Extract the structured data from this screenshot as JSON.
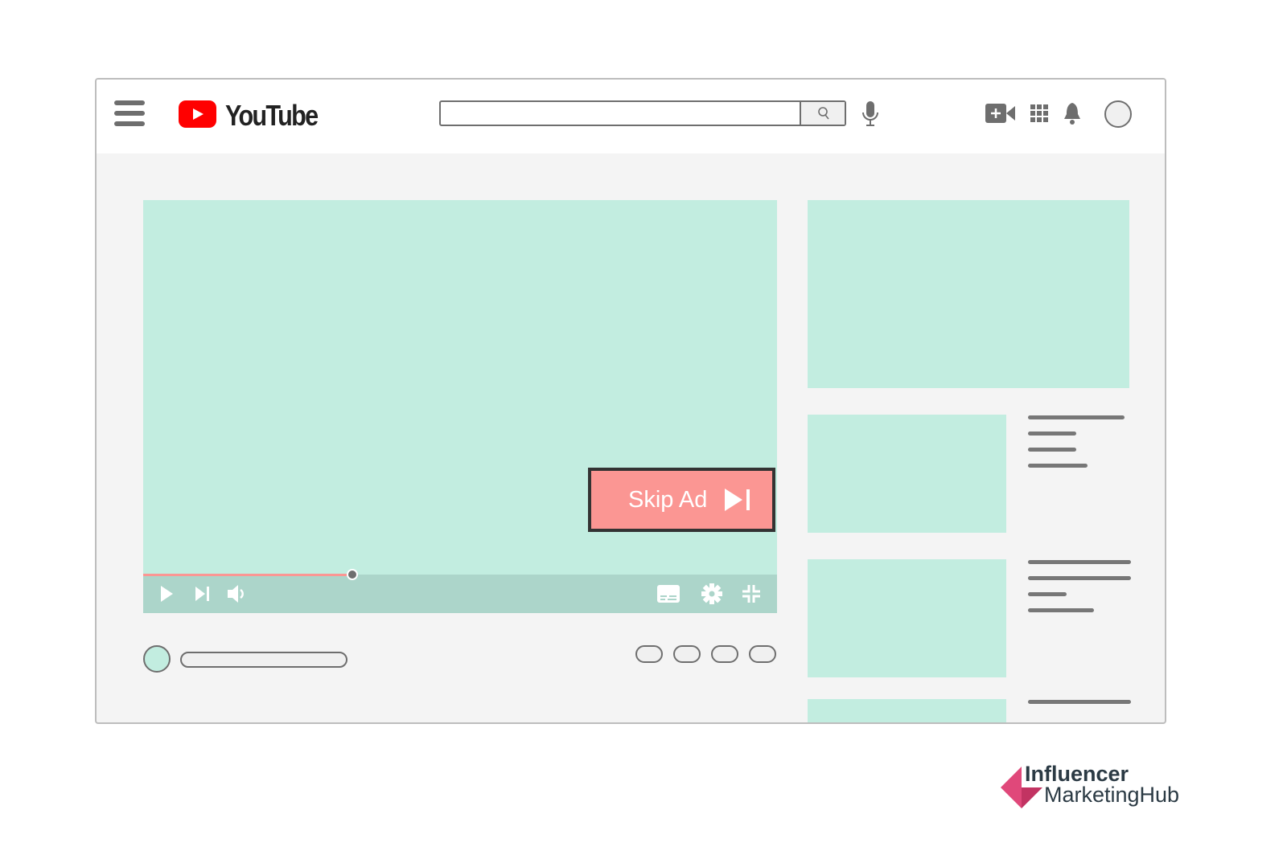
{
  "header": {
    "logo_text": "YouTube",
    "brand_color": "#ff0000",
    "search": {
      "value": "",
      "placeholder": ""
    },
    "icons": [
      "menu-icon",
      "search-icon",
      "microphone-icon",
      "create-video-icon",
      "apps-grid-icon",
      "bell-icon",
      "avatar"
    ]
  },
  "player": {
    "skip_ad_label": "Skip Ad",
    "skip_ad_color": "#fb9693",
    "progress_fraction": 0.33,
    "controls": [
      "play-icon",
      "next-icon",
      "volume-icon",
      "captions-icon",
      "settings-icon",
      "exit-fullscreen-icon"
    ]
  },
  "watermark": {
    "line1": "Influencer",
    "line2": "MarketingHub"
  }
}
